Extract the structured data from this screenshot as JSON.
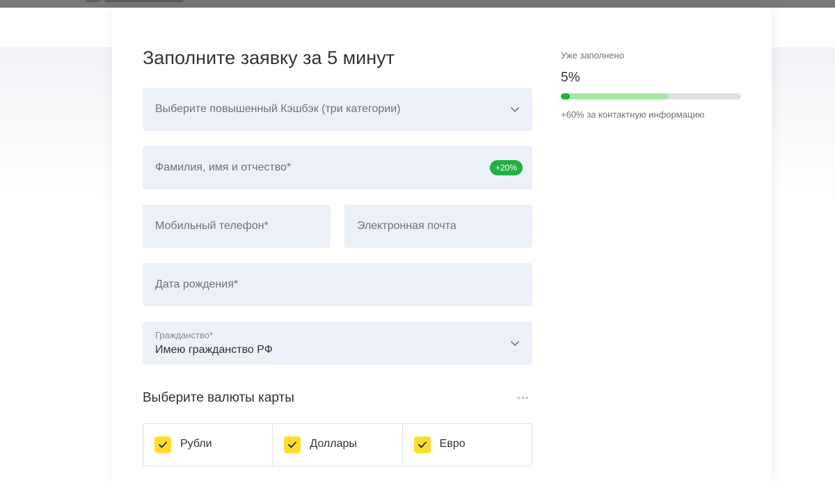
{
  "form": {
    "title": "Заполните заявку за 5 минут",
    "cashback_placeholder": "Выберите повышенный Кэшбэк (три категории)",
    "fullname_placeholder": "Фамилия, имя и отчество*",
    "fullname_badge": "+20%",
    "phone_placeholder": "Мобильный телефон*",
    "email_placeholder": "Электронная почта",
    "birthdate_placeholder": "Дата рождения*",
    "citizenship_label": "Гражданство*",
    "citizenship_value": "Имею гражданство РФ"
  },
  "currencies": {
    "heading": "Выберите валюты карты",
    "options": [
      {
        "label": "Рубли",
        "checked": true
      },
      {
        "label": "Доллары",
        "checked": true
      },
      {
        "label": "Евро",
        "checked": true
      }
    ]
  },
  "progress": {
    "label": "Уже заполнено",
    "percent_text": "5%",
    "percent": 5,
    "projected_percent": 60,
    "hint": "+60% за контактную информацию"
  },
  "colors": {
    "field_bg": "#ecf0f7",
    "accent_green": "#1fb141",
    "light_green": "#a7e6a4",
    "checkbox_yellow": "#ffdd2d"
  },
  "icons": {
    "dropdown": "chevron-down-icon",
    "checkbox": "check-icon",
    "more": "more-dots-icon"
  }
}
